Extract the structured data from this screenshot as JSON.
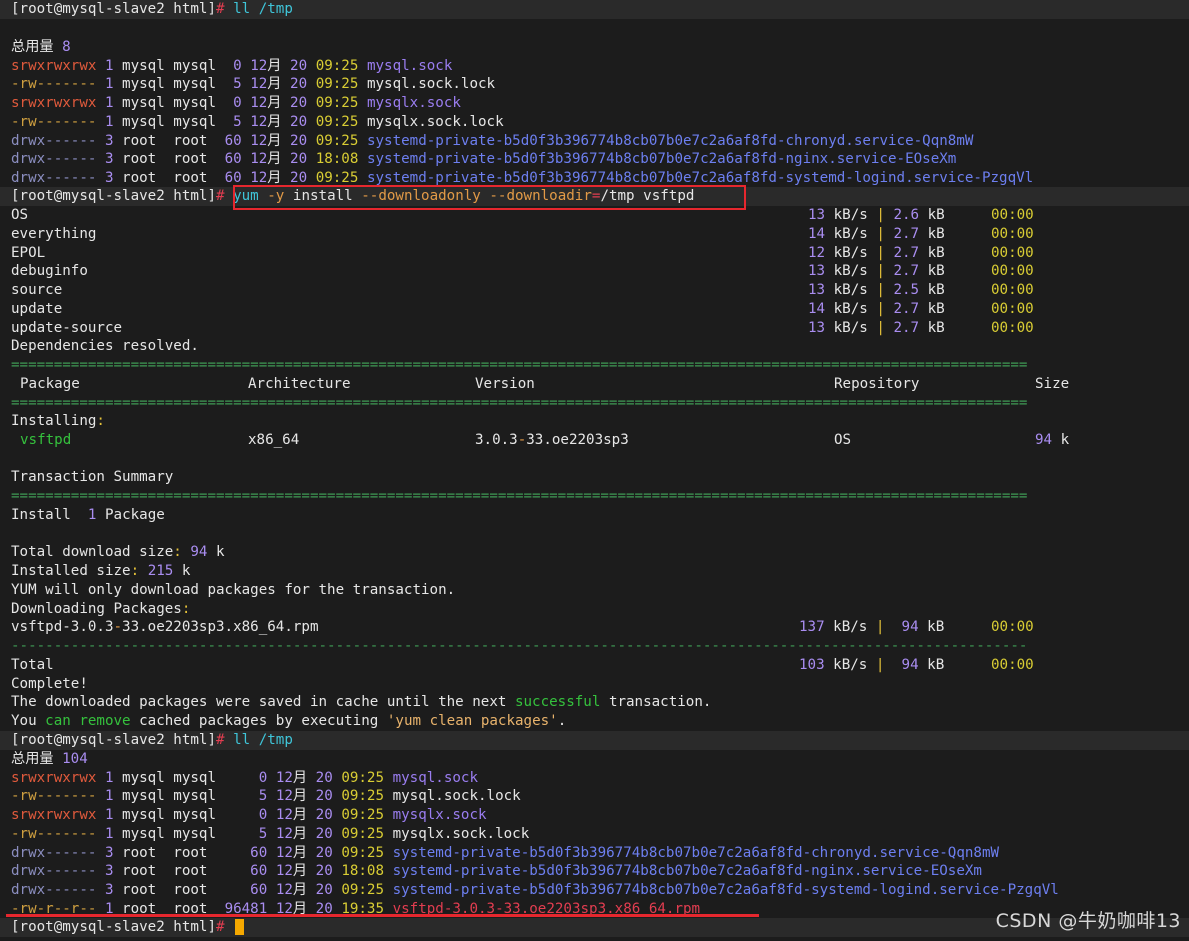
{
  "prompt": "[root@mysql-slave2 html]",
  "cmd1": "ll /tmp",
  "total1_label": "总用量",
  "total1_value": "8",
  "listing1": [
    {
      "perm": "srwxrwxrwx",
      "links": "1",
      "owner": "mysql",
      "group": "mysql",
      "size": "0",
      "month": "12月",
      "day": "20",
      "time": "09:25",
      "name": "mysql.sock",
      "kind": "socket"
    },
    {
      "perm": "-rw-------",
      "links": "1",
      "owner": "mysql",
      "group": "mysql",
      "size": "5",
      "month": "12月",
      "day": "20",
      "time": "09:25",
      "name": "mysql.sock.lock",
      "kind": "file"
    },
    {
      "perm": "srwxrwxrwx",
      "links": "1",
      "owner": "mysql",
      "group": "mysql",
      "size": "0",
      "month": "12月",
      "day": "20",
      "time": "09:25",
      "name": "mysqlx.sock",
      "kind": "socket"
    },
    {
      "perm": "-rw-------",
      "links": "1",
      "owner": "mysql",
      "group": "mysql",
      "size": "5",
      "month": "12月",
      "day": "20",
      "time": "09:25",
      "name": "mysqlx.sock.lock",
      "kind": "file"
    },
    {
      "perm": "drwx------",
      "links": "3",
      "owner": "root",
      "group": "root",
      "size": "60",
      "month": "12月",
      "day": "20",
      "time": "09:25",
      "name": "systemd-private-b5d0f3b396774b8cb07b0e7c2a6af8fd-chronyd.service-Qqn8mW",
      "kind": "dir"
    },
    {
      "perm": "drwx------",
      "links": "3",
      "owner": "root",
      "group": "root",
      "size": "60",
      "month": "12月",
      "day": "20",
      "time": "18:08",
      "name": "systemd-private-b5d0f3b396774b8cb07b0e7c2a6af8fd-nginx.service-EOseXm",
      "kind": "dir"
    },
    {
      "perm": "drwx------",
      "links": "3",
      "owner": "root",
      "group": "root",
      "size": "60",
      "month": "12月",
      "day": "20",
      "time": "09:25",
      "name": "systemd-private-b5d0f3b396774b8cb07b0e7c2a6af8fd-systemd-logind.service-PzgqVl",
      "kind": "dir"
    }
  ],
  "cmd2": {
    "yum": "yum",
    "flag": "-y",
    "install": "install",
    "opt1": "--downloadonly",
    "opt2": "--downloadir",
    "eq": "=",
    "path": "/tmp",
    "pkg": "vsftpd"
  },
  "repos": [
    {
      "name": "OS",
      "speed": "13",
      "size": "2.6",
      "time": "00:00"
    },
    {
      "name": "everything",
      "speed": "14",
      "size": "2.7",
      "time": "00:00"
    },
    {
      "name": "EPOL",
      "speed": "12",
      "size": "2.7",
      "time": "00:00"
    },
    {
      "name": "debuginfo",
      "speed": "13",
      "size": "2.7",
      "time": "00:00"
    },
    {
      "name": "source",
      "speed": "13",
      "size": "2.5",
      "time": "00:00"
    },
    {
      "name": "update",
      "speed": "14",
      "size": "2.7",
      "time": "00:00"
    },
    {
      "name": "update-source",
      "speed": "13",
      "size": "2.7",
      "time": "00:00"
    }
  ],
  "units": {
    "kbs": "kB/s",
    "kb": "kB",
    "pipe": "|",
    "k": "k"
  },
  "deps_resolved": "Dependencies resolved.",
  "rule_eq": "=======================================================================================================================",
  "rule_dash": "-----------------------------------------------------------------------------------------------------------------------",
  "headers": {
    "package": "Package",
    "arch": "Architecture",
    "version": "Version",
    "repo": "Repository",
    "size": "Size"
  },
  "installing_label": "Installing",
  "pkg_row": {
    "name": "vsftpd",
    "arch": "x86_64",
    "version_a": "3.0.3",
    "version_b": "33.oe2203sp3",
    "repo": "OS",
    "size": "94"
  },
  "summary_title": "Transaction Summary",
  "install_label": "Install",
  "install_count": "1",
  "install_unit": "Package",
  "total_dl_label": "Total download size",
  "total_dl_value": "94",
  "installed_size_label": "Installed size",
  "installed_size_value": "215",
  "yum_note": "YUM will only download packages for the transaction.",
  "downloading_label": "Downloading Packages",
  "rpm_name_a": "vsftpd-3.0.3",
  "rpm_name_b": "33.oe2203sp3.x86_64.rpm",
  "rpm_speed": "137",
  "rpm_size": "94",
  "rpm_time": "00:00",
  "total_label": "Total",
  "total_speed": "103",
  "total_size": "94",
  "total_time": "00:00",
  "complete": "Complete!",
  "saved_a": "The downloaded packages were saved in cache until the next",
  "saved_success": "successful",
  "saved_b": "transaction.",
  "remove_you": "You",
  "remove_can": "can",
  "remove_remove": "remove",
  "remove_mid": "cached packages by executing",
  "remove_cmd": "'yum clean packages'",
  "remove_end": ".",
  "cmd3": "ll /tmp",
  "total2_label": "总用量",
  "total2_value": "104",
  "listing2": [
    {
      "perm": "srwxrwxrwx",
      "links": "1",
      "owner": "mysql",
      "group": "mysql",
      "size": "0",
      "month": "12月",
      "day": "20",
      "time": "09:25",
      "name": "mysql.sock",
      "kind": "socket"
    },
    {
      "perm": "-rw-------",
      "links": "1",
      "owner": "mysql",
      "group": "mysql",
      "size": "5",
      "month": "12月",
      "day": "20",
      "time": "09:25",
      "name": "mysql.sock.lock",
      "kind": "file"
    },
    {
      "perm": "srwxrwxrwx",
      "links": "1",
      "owner": "mysql",
      "group": "mysql",
      "size": "0",
      "month": "12月",
      "day": "20",
      "time": "09:25",
      "name": "mysqlx.sock",
      "kind": "socket"
    },
    {
      "perm": "-rw-------",
      "links": "1",
      "owner": "mysql",
      "group": "mysql",
      "size": "5",
      "month": "12月",
      "day": "20",
      "time": "09:25",
      "name": "mysqlx.sock.lock",
      "kind": "file"
    },
    {
      "perm": "drwx------",
      "links": "3",
      "owner": "root",
      "group": "root",
      "size": "60",
      "month": "12月",
      "day": "20",
      "time": "09:25",
      "name": "systemd-private-b5d0f3b396774b8cb07b0e7c2a6af8fd-chronyd.service-Qqn8mW",
      "kind": "dir"
    },
    {
      "perm": "drwx------",
      "links": "3",
      "owner": "root",
      "group": "root",
      "size": "60",
      "month": "12月",
      "day": "20",
      "time": "18:08",
      "name": "systemd-private-b5d0f3b396774b8cb07b0e7c2a6af8fd-nginx.service-EOseXm",
      "kind": "dir"
    },
    {
      "perm": "drwx------",
      "links": "3",
      "owner": "root",
      "group": "root",
      "size": "60",
      "month": "12月",
      "day": "20",
      "time": "09:25",
      "name": "systemd-private-b5d0f3b396774b8cb07b0e7c2a6af8fd-systemd-logind.service-PzgqVl",
      "kind": "dir"
    },
    {
      "perm": "-rw-r--r--",
      "links": "1",
      "owner": "root",
      "group": "root",
      "size": "96481",
      "month": "12月",
      "day": "20",
      "time": "19:35",
      "name": "vsftpd-3.0.3-33.oe2203sp3.x86_64.rpm",
      "kind": "rpm"
    }
  ],
  "watermark": "CSDN @牛奶咖啡13"
}
